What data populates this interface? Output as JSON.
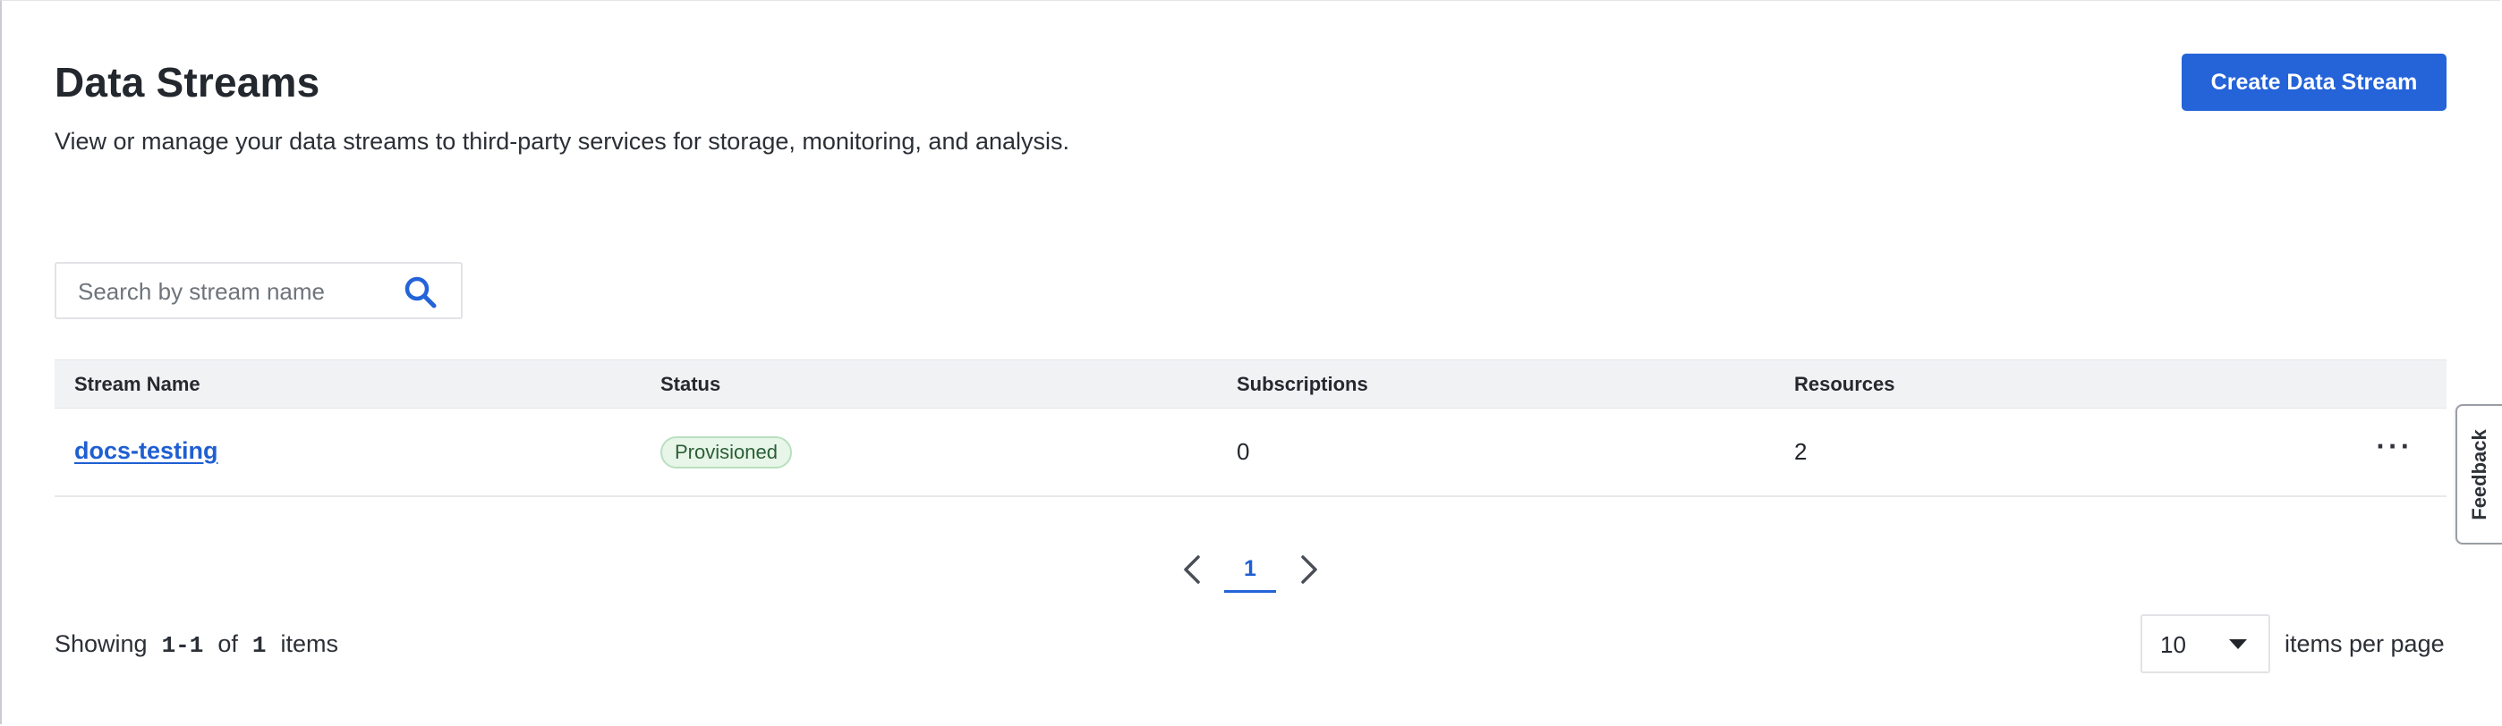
{
  "header": {
    "title": "Data Streams",
    "subtitle": "View or manage your data streams to third-party services for storage, monitoring, and analysis.",
    "create_button_label": "Create Data Stream"
  },
  "search": {
    "placeholder": "Search by stream name",
    "value": "",
    "icon": "search-icon"
  },
  "table": {
    "columns": [
      "Stream Name",
      "Status",
      "Subscriptions",
      "Resources"
    ],
    "rows": [
      {
        "stream_name": "docs-testing",
        "status": "Provisioned",
        "subscriptions": "0",
        "resources": "2",
        "actions_icon": "more-horizontal-icon",
        "actions_label": "···"
      }
    ]
  },
  "pagination": {
    "current_page": "1",
    "prev_icon": "chevron-left-icon",
    "next_icon": "chevron-right-icon"
  },
  "footer": {
    "showing_prefix": "Showing",
    "range": "1-1",
    "of_label": "of",
    "total": "1",
    "items_label": "items",
    "per_page_value": "10",
    "per_page_label": "items per page"
  },
  "feedback": {
    "label": "Feedback"
  },
  "colors": {
    "accent": "#2463d8",
    "link": "#1f5fd1",
    "status_bg": "#e7f6e9",
    "status_border": "#b9e0bf",
    "header_bg": "#f1f2f4"
  }
}
